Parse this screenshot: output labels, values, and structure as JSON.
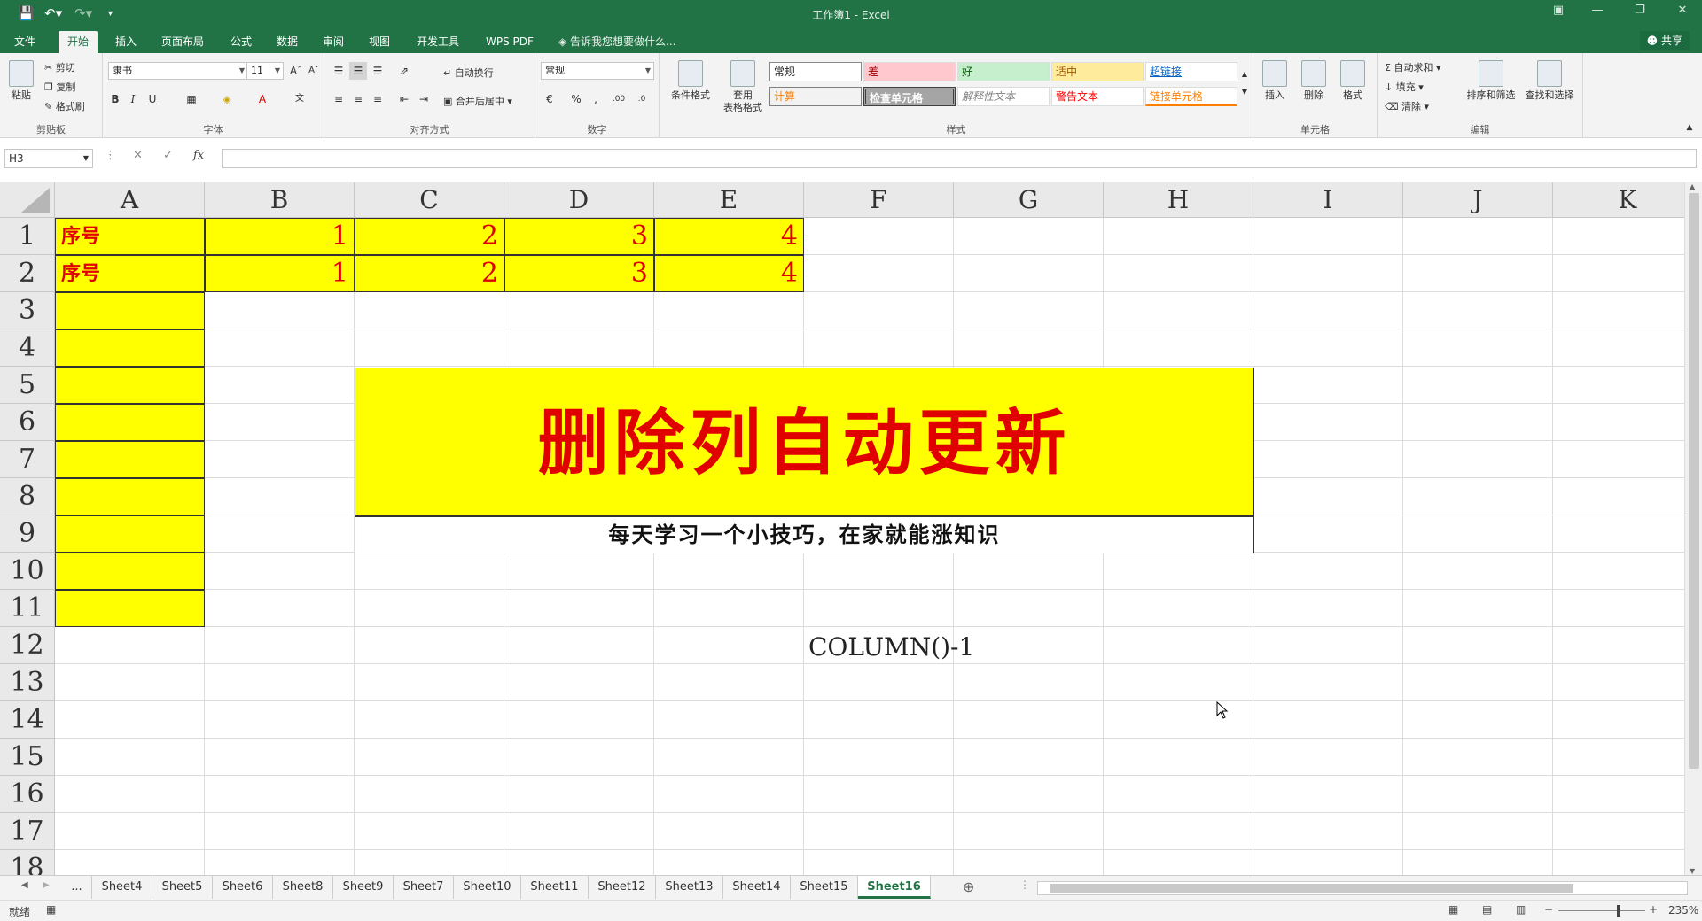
{
  "window": {
    "title": "工作簿1 - Excel"
  },
  "ribbon_tabs": [
    "文件",
    "开始",
    "插入",
    "页面布局",
    "公式",
    "数据",
    "审阅",
    "视图",
    "开发工具",
    "WPS PDF"
  ],
  "tell_me": "告诉我您想要做什么...",
  "share": "共享",
  "clipboard": {
    "paste": "粘贴",
    "cut": "剪切",
    "copy": "复制",
    "format_painter": "格式刷",
    "label": "剪贴板"
  },
  "font": {
    "name": "隶书",
    "size": "11",
    "label": "字体"
  },
  "alignment": {
    "wrap": "自动换行",
    "merge": "合并后居中",
    "label": "对齐方式"
  },
  "number": {
    "format": "常规",
    "label": "数字"
  },
  "styles": {
    "cond_format": "条件格式",
    "table_format": "套用\n表格格式",
    "cells": [
      "常规",
      "差",
      "好",
      "适中",
      "超链接",
      "计算",
      "检查单元格",
      "解释性文本",
      "警告文本",
      "链接单元格"
    ],
    "label": "样式"
  },
  "cells_group": {
    "insert": "插入",
    "delete": "删除",
    "format": "格式",
    "label": "单元格"
  },
  "editing": {
    "autosum": "自动求和",
    "fill": "填充",
    "clear": "清除",
    "sort": "排序和筛选",
    "find": "查找和选择",
    "label": "编辑"
  },
  "formula_bar": {
    "name_box": "H3",
    "fx": "fx",
    "value": ""
  },
  "columns": [
    "A",
    "B",
    "C",
    "D",
    "E",
    "F",
    "G",
    "H",
    "I",
    "J",
    "K"
  ],
  "rows": [
    "1",
    "2",
    "3",
    "4",
    "5",
    "6",
    "7",
    "8",
    "9",
    "10",
    "11",
    "12",
    "13",
    "14",
    "15",
    "16",
    "17",
    "18"
  ],
  "data_rows": [
    {
      "label": "序号",
      "values": [
        "1",
        "2",
        "3",
        "4"
      ]
    },
    {
      "label": "序号",
      "values": [
        "1",
        "2",
        "3",
        "4"
      ]
    }
  ],
  "banner": {
    "title": "删除列自动更新",
    "subtitle": "每天学习一个小技巧，在家就能涨知识"
  },
  "formula_note": "COLUMN()-1",
  "sheets": [
    "...",
    "Sheet4",
    "Sheet5",
    "Sheet6",
    "Sheet8",
    "Sheet9",
    "Sheet7",
    "Sheet10",
    "Sheet11",
    "Sheet12",
    "Sheet13",
    "Sheet14",
    "Sheet15",
    "Sheet16"
  ],
  "active_sheet": "Sheet16",
  "status": {
    "ready": "就绪",
    "zoom": "235%"
  }
}
